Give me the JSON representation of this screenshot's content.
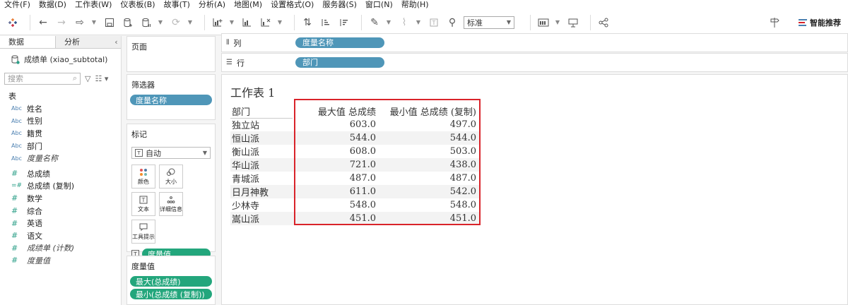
{
  "menu": [
    "文件(F)",
    "数据(D)",
    "工作表(W)",
    "仪表板(B)",
    "故事(T)",
    "分析(A)",
    "地图(M)",
    "设置格式(O)",
    "服务器(S)",
    "窗口(N)",
    "帮助(H)"
  ],
  "toolbar": {
    "view_size_select": "标准",
    "smart_recommend_label": "智能推荐",
    "accent_colors": [
      "#4a7fb0",
      "#d9232a",
      "#2c9f88"
    ]
  },
  "left_pane": {
    "tab_data": "数据",
    "tab_analysis": "分析",
    "collapse_glyph": "‹",
    "datasource": "成绩单 (xiao_subtotal)",
    "search_placeholder": "搜索",
    "section_table": "表",
    "dimension_fields": [
      {
        "type": "Abc",
        "name": "姓名"
      },
      {
        "type": "Abc",
        "name": "性别"
      },
      {
        "type": "Abc",
        "name": "籍贯"
      },
      {
        "type": "Abc",
        "name": "部门"
      },
      {
        "type": "Abc",
        "name": "度量名称"
      }
    ],
    "measure_fields": [
      {
        "type": "#",
        "name": "总成绩"
      },
      {
        "type": "=#",
        "name": "总成绩 (复制)"
      },
      {
        "type": "#",
        "name": "数学"
      },
      {
        "type": "#",
        "name": "综合"
      },
      {
        "type": "#",
        "name": "英语"
      },
      {
        "type": "#",
        "name": "语文"
      },
      {
        "type": "#",
        "name": "成绩单 (计数)"
      },
      {
        "type": "#",
        "name": "度量值"
      }
    ]
  },
  "cards": {
    "pages_title": "页面",
    "filters_title": "筛选器",
    "filters_pill": "度量名称",
    "marks_title": "标记",
    "marks_type": "自动",
    "marks_buttons": [
      "颜色",
      "大小",
      "文本",
      "详细信息",
      "工具提示"
    ],
    "marks_pill": "度量值",
    "measure_values_title": "度量值",
    "measure_values_pills": [
      "最大(总成绩)",
      "最小(总成绩 (复制))"
    ]
  },
  "shelves": {
    "columns_label": "列",
    "columns_pill": "度量名称",
    "rows_label": "行",
    "rows_pill": "部门"
  },
  "view": {
    "title": "工作表 1",
    "col_header": "部门",
    "measure_headers": [
      "最大值 总成绩",
      "最小值 总成绩 (复制)"
    ],
    "rows": [
      {
        "dept": "独立站",
        "max": "603.0",
        "min": "497.0"
      },
      {
        "dept": "恒山派",
        "max": "544.0",
        "min": "544.0"
      },
      {
        "dept": "衡山派",
        "max": "608.0",
        "min": "503.0"
      },
      {
        "dept": "华山派",
        "max": "721.0",
        "min": "438.0"
      },
      {
        "dept": "青城派",
        "max": "487.0",
        "min": "487.0"
      },
      {
        "dept": "日月神教",
        "max": "611.0",
        "min": "542.0"
      },
      {
        "dept": "少林寺",
        "max": "548.0",
        "min": "548.0"
      },
      {
        "dept": "嵩山派",
        "max": "451.0",
        "min": "451.0"
      }
    ]
  }
}
